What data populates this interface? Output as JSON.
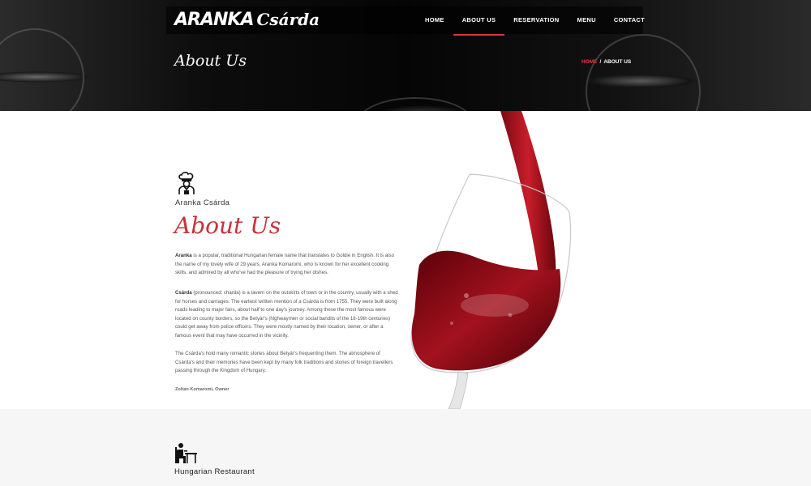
{
  "brand": {
    "name_part1": "ARANKA",
    "name_part2": "Csárda"
  },
  "nav": {
    "items": [
      {
        "label": "HOME"
      },
      {
        "label": "ABOUT US"
      },
      {
        "label": "RESERVATION"
      },
      {
        "label": "MENU"
      },
      {
        "label": "CONTACT"
      }
    ],
    "active_index": 1
  },
  "header": {
    "title": "About Us",
    "breadcrumb": {
      "home": "HOME",
      "separator": "/",
      "current": "ABOUT US"
    }
  },
  "about": {
    "eyebrow": "Aranka Csárda",
    "heading": "About Us",
    "p1_bold": "Aranka",
    "p1_text": " is a popular, traditional Hungarian female name that translates to Goldie in English. It is also the name of my lovely wife of 29 years, Aranka Komaromi, who is known for her excellent cooking skills, and admired by all who've had the pleasure of trying her dishes.",
    "p2_bold": "Csárda",
    "p2_text": " (pronounced: charda) is a tavern on the outskirts of town or in the country, usually with a shed for horses and carriages. The earliest written mention of a Csárda is from 1755. They were built along roads leading to major fairs, about half to one day's journey. Among these the most famous were located on county borders, so the Betyár's (highwaymen or social bandits of the 18-19th centuries) could get away from police officers. They were mostly named by their location, owner, or after a famous event that may have occurred in the vicinity.",
    "p3_text": "The Csárda's hold many romantic stories about Betyár's frequenting them. The atmosphere of Csárda's and their memories have been kept by many folk traditions and stories of foreign travellers passing through the Kingdom of Hungary.",
    "signature": "Zoltan Komaromi, Owner"
  },
  "restaurant": {
    "label": "Hungarian Restaurant"
  },
  "colors": {
    "accent": "#c8313a",
    "wine": "#8e0c17",
    "dark": "#0b0b0b",
    "section_bg": "#f6f6f6"
  },
  "icons": {
    "chef": "chef-icon",
    "diner": "diner-table-icon",
    "wine": "wine-glass-image"
  }
}
